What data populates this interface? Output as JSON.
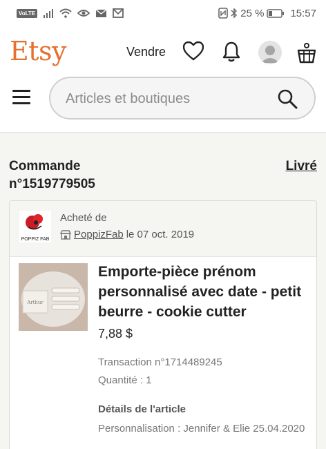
{
  "statusbar": {
    "volte": "VoLTE",
    "battery_percent": "25 %",
    "time": "15:57"
  },
  "header": {
    "logo": "Etsy",
    "sell_label": "Vendre"
  },
  "search": {
    "placeholder": "Articles et boutiques"
  },
  "order": {
    "title": "Commande n°1519779505",
    "status": "Livré",
    "bought_from_label": "Acheté de",
    "shop_logo_text": "POPPIZ FAB",
    "shop_name": "PoppizFab",
    "purchase_date": "le 07 oct. 2019"
  },
  "item": {
    "title": "Emporte-pièce prénom personnalisé avec date - petit beurre - cookie cutter",
    "price": "7,88 $",
    "transaction": "Transaction n°1714489245",
    "quantity": "Quantité : 1",
    "details_heading": "Détails de l'article",
    "details_value": "Personnalisation : Jennifer & Elie 25.04.2020",
    "thumbnail_text": "Arthur"
  },
  "icons": {
    "heart": "heart-icon",
    "bell": "bell-icon",
    "basket": "basket-icon",
    "search": "search-icon",
    "menu": "menu-icon",
    "shop": "shop-icon"
  },
  "colors": {
    "brand": "#e5702f",
    "background": "#f5f5f1"
  }
}
